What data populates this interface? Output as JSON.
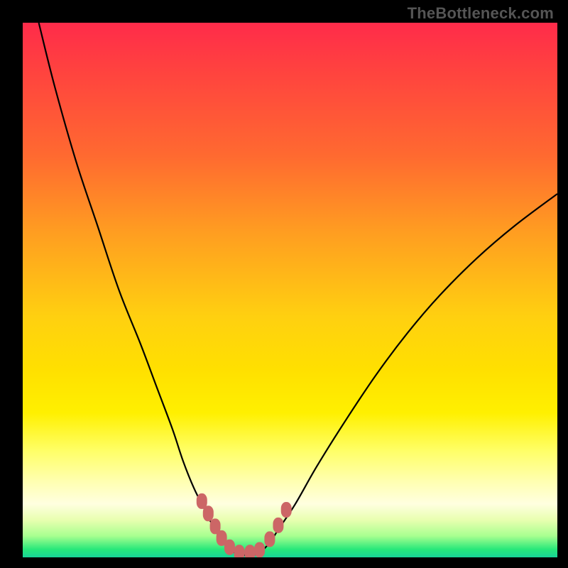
{
  "watermark": "TheBottleneck.com",
  "chart_data": {
    "type": "line",
    "title": "",
    "xlabel": "",
    "ylabel": "",
    "xlim": [
      0,
      100
    ],
    "ylim": [
      0,
      100
    ],
    "grid": false,
    "legend": false,
    "series": [
      {
        "name": "left-curve",
        "x": [
          3,
          6,
          10,
          14,
          18,
          22,
          25,
          28,
          30,
          32,
          34,
          35.5,
          37,
          38.5,
          40
        ],
        "y": [
          100,
          88,
          74,
          62,
          50,
          40,
          32,
          24,
          18,
          13,
          9,
          6,
          3.5,
          1.8,
          0.6
        ]
      },
      {
        "name": "right-curve",
        "x": [
          44,
          46,
          48,
          51,
          55,
          60,
          66,
          72,
          78,
          85,
          92,
          100
        ],
        "y": [
          0.6,
          2.5,
          5.5,
          10,
          17,
          25,
          34,
          42,
          49,
          56,
          62,
          68
        ]
      },
      {
        "name": "bottom-flat",
        "x": [
          40,
          42,
          44
        ],
        "y": [
          0.6,
          0.4,
          0.6
        ]
      }
    ],
    "markers": {
      "name": "highlight-beads",
      "color": "#cc6666",
      "points": [
        {
          "x": 33.5,
          "y": 10.5
        },
        {
          "x": 34.7,
          "y": 8.2
        },
        {
          "x": 36.0,
          "y": 5.8
        },
        {
          "x": 37.2,
          "y": 3.6
        },
        {
          "x": 38.7,
          "y": 1.9
        },
        {
          "x": 40.5,
          "y": 0.9
        },
        {
          "x": 42.5,
          "y": 0.9
        },
        {
          "x": 44.3,
          "y": 1.4
        },
        {
          "x": 46.2,
          "y": 3.4
        },
        {
          "x": 47.8,
          "y": 6.0
        },
        {
          "x": 49.3,
          "y": 8.9
        }
      ]
    },
    "colors": {
      "curve": "#000000",
      "marker": "#cc6666",
      "gradient_top": "#ff2b4a",
      "gradient_mid": "#ffe000",
      "gradient_bottom": "#18d498"
    }
  }
}
